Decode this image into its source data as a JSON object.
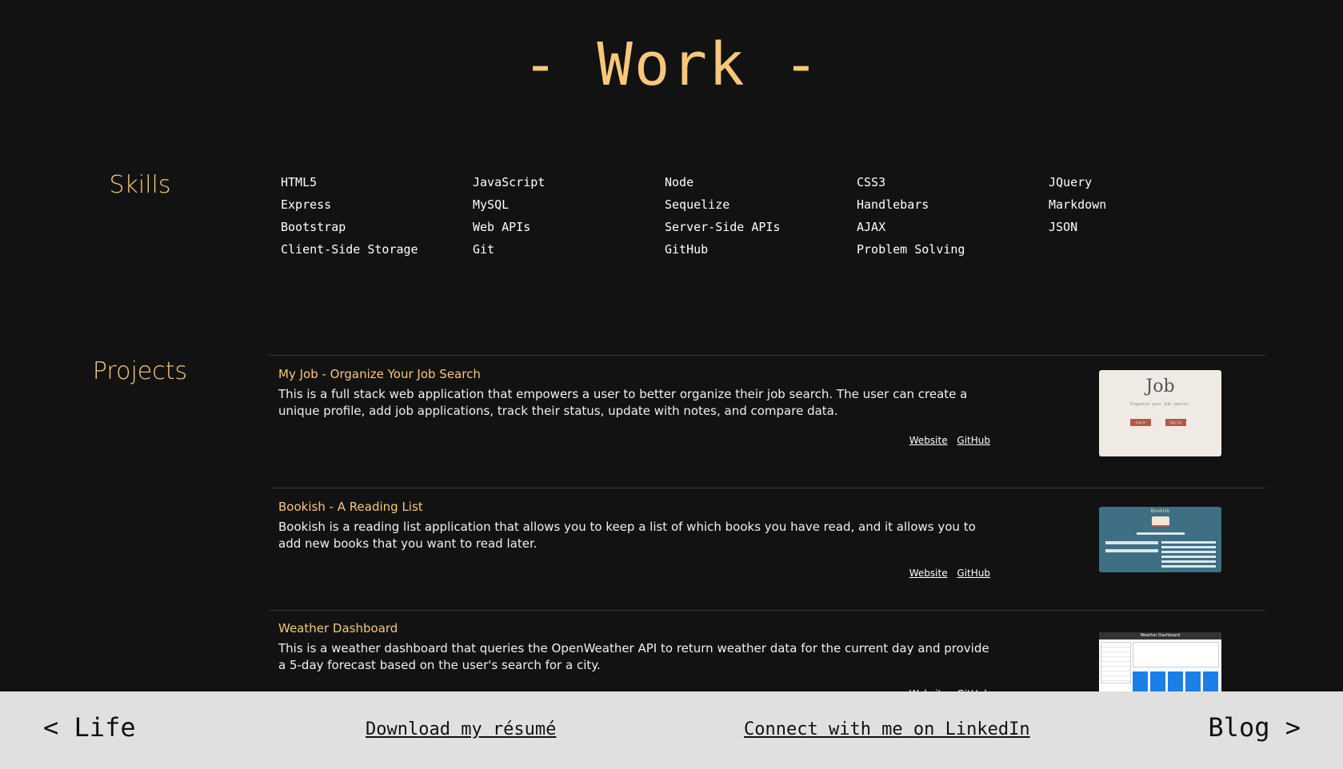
{
  "header": {
    "title": "- Work -"
  },
  "skills": {
    "heading": "Skills",
    "items": [
      "HTML5",
      "JavaScript",
      "Node",
      "CSS3",
      "JQuery",
      "Express",
      "MySQL",
      "Sequelize",
      "Handlebars",
      "Markdown",
      "Bootstrap",
      "Web APIs",
      "Server-Side APIs",
      "AJAX",
      "JSON",
      "Client-Side Storage",
      "Git",
      "GitHub",
      "Problem Solving"
    ]
  },
  "projects": {
    "heading": "Projects",
    "items": [
      {
        "title": "My Job - Organize Your Job Search",
        "description": "This is a full stack web application that empowers a user to better organize their job search. The user can create a unique profile, add job applications, track their status, update with notes, and compare data.",
        "website_label": "Website",
        "github_label": "GitHub",
        "thumbnail": {
          "logo_text": "Job",
          "tagline": "Organize your job search.",
          "button_1": "Log In",
          "button_2": "Sign Up"
        }
      },
      {
        "title": "Bookish - A Reading List",
        "description": "Bookish is a reading list application that allows you to keep a list of which books you have read, and it allows you to add new books that you want to read later.",
        "website_label": "Website",
        "github_label": "GitHub",
        "thumbnail": {
          "logo_text": "Bookish"
        }
      },
      {
        "title": "Weather Dashboard",
        "description": "This is a weather dashboard that queries the OpenWeather API to return weather data for the current day and provide a 5-day forecast based on the user's search for a city.",
        "website_label": "Website",
        "github_label": "GitHub",
        "thumbnail": {
          "logo_text": "Weather Dashboard"
        }
      }
    ]
  },
  "footer": {
    "prev_label": "< Life",
    "resume_label": "Download my résumé",
    "linkedin_label": "Connect with me on LinkedIn",
    "next_label": "Blog >"
  },
  "colors": {
    "background": "#121212",
    "accent": "#f8c77a",
    "footer_bg": "#e0e0e0"
  }
}
